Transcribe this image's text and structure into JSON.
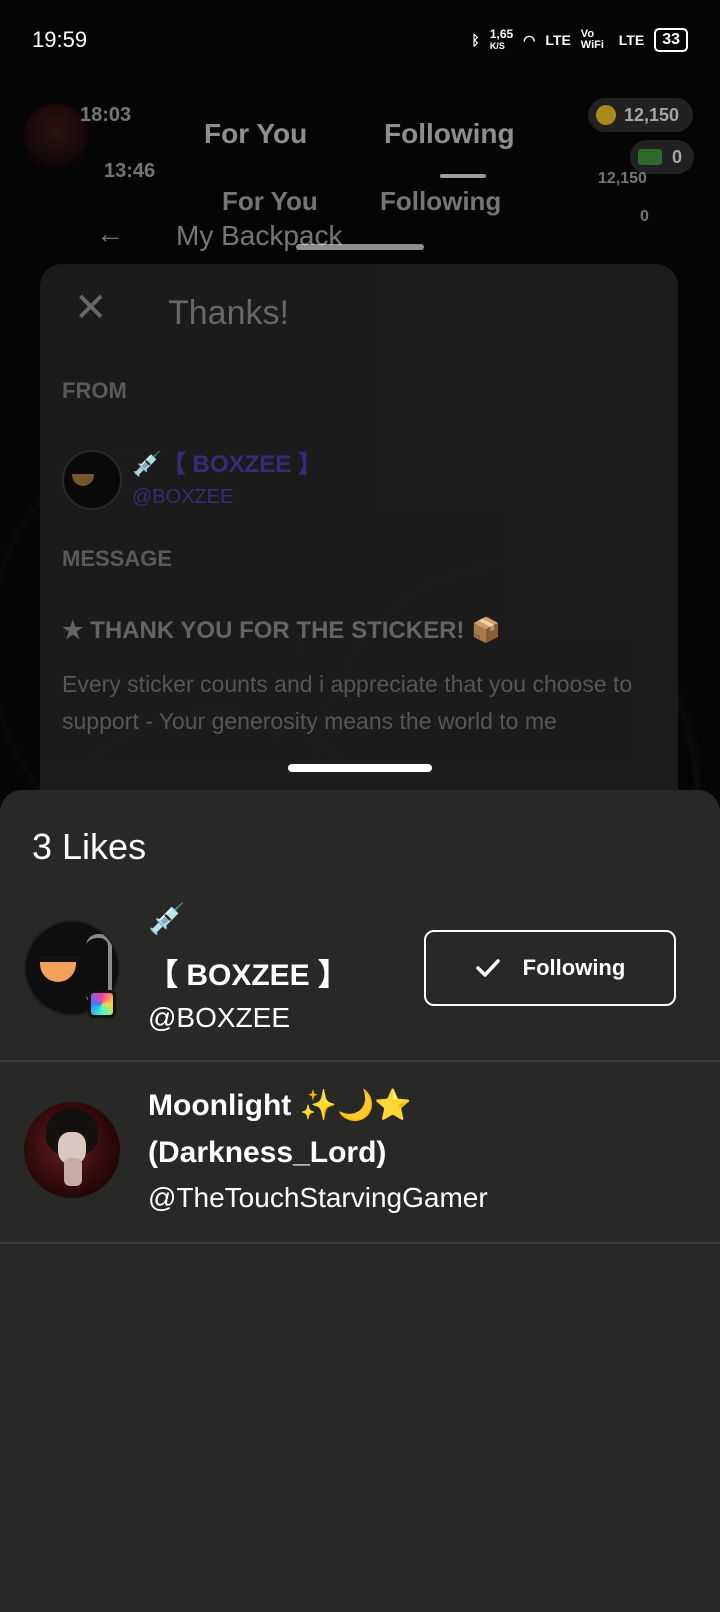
{
  "status_bar": {
    "time": "19:59",
    "net_speed": "1,65",
    "net_unit": "K/S",
    "lte1": "LTE",
    "vowifi": "Vo WiFi",
    "lte2": "LTE",
    "battery": "33"
  },
  "background": {
    "tabs": [
      "For You",
      "Following"
    ],
    "ghost_time": "18:03",
    "ghost_time2": "13:46",
    "ghost_tabs": [
      "For You",
      "Following"
    ],
    "ghost_title": "My Backpack",
    "coins": "12,150",
    "props": "0",
    "ghost_coins": "12,150",
    "ghost_props": "0"
  },
  "dialog": {
    "close_glyph": "✕",
    "title": "Thanks!",
    "from_label": "FROM",
    "from_name": "💉【 BOXZEE 】",
    "from_handle": "@BOXZEE",
    "message_label": "MESSAGE",
    "message_title": "★ THANK YOU FOR THE STICKER! 📦",
    "message_body": "Every sticker counts and i appreciate that you choose to support - Your generosity means the world to me"
  },
  "likes_sheet": {
    "title": "3 Likes",
    "users": [
      {
        "emoji": "💉",
        "name": "【 BOXZEE 】",
        "handle": "@BOXZEE",
        "follow_label": "Following"
      },
      {
        "name_line1": "Moonlight ✨🌙⭐",
        "name_line2": "(Darkness_Lord)",
        "handle": "@TheTouchStarvingGamer"
      }
    ]
  }
}
